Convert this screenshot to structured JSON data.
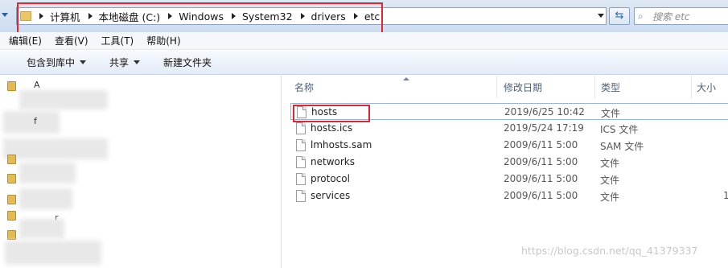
{
  "address": {
    "crumbs": [
      "计算机",
      "本地磁盘 (C:)",
      "Windows",
      "System32",
      "drivers",
      "etc"
    ],
    "search_placeholder": "搜索 etc"
  },
  "menu": [
    "编辑(E)",
    "查看(V)",
    "工具(T)",
    "帮助(H)"
  ],
  "toolbar": {
    "include_label": "包含到库中",
    "share_label": "共享",
    "new_folder_label": "新建文件夹"
  },
  "columns": {
    "name": "名称",
    "date": "修改日期",
    "type": "类型",
    "size": "大小"
  },
  "files": [
    {
      "name": "hosts",
      "date": "2019/6/25 10:42",
      "type": "文件"
    },
    {
      "name": "hosts.ics",
      "date": "2019/5/24 17:19",
      "type": "ICS 文件"
    },
    {
      "name": "lmhosts.sam",
      "date": "2009/6/11 5:00",
      "type": "SAM 文件"
    },
    {
      "name": "networks",
      "date": "2009/6/11 5:00",
      "type": "文件"
    },
    {
      "name": "protocol",
      "date": "2009/6/11 5:00",
      "type": "文件"
    },
    {
      "name": "services",
      "date": "2009/6/11 5:00",
      "type": "文件",
      "size_partial": "1"
    }
  ],
  "nav_fragments": [
    "A",
    "f",
    "r"
  ],
  "watermark": "https://blog.csdn.net/qq_41379337",
  "colors": {
    "highlight": "#e0262e",
    "folder": "#e3bb55"
  }
}
